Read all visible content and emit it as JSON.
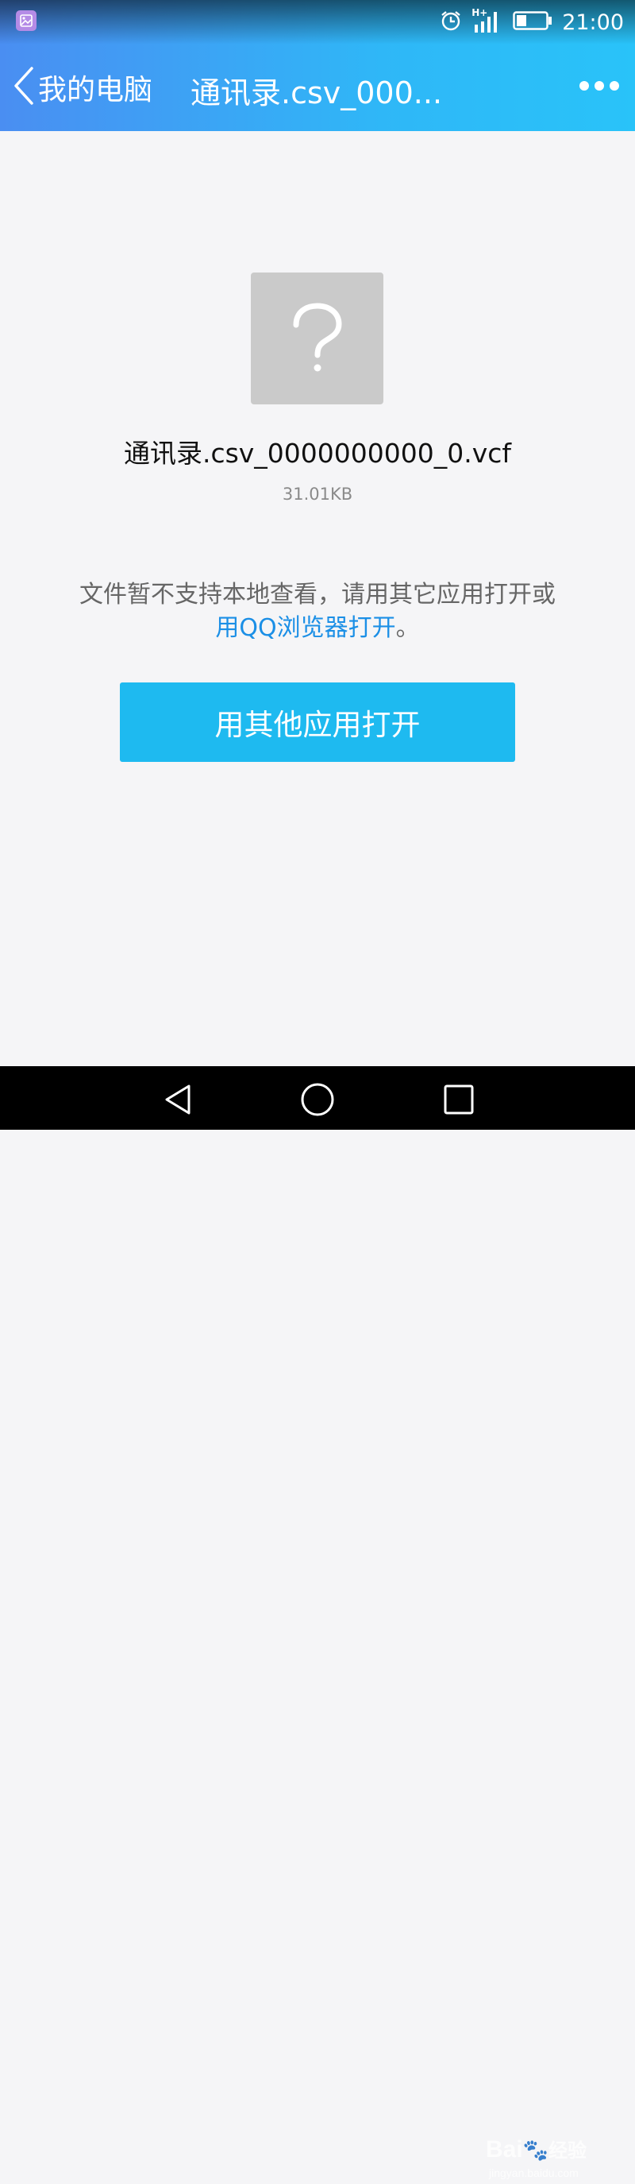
{
  "status_bar": {
    "time": "21:00",
    "network": "H+"
  },
  "title_bar": {
    "back_label": "我的电脑",
    "title": "通讯录.csv_000..."
  },
  "file": {
    "name": "通讯录.csv_0000000000_0.vcf",
    "size": "31.01KB",
    "icon": "question-mark-icon"
  },
  "message": {
    "line1": "文件暂不支持本地查看，请用其它应用打开或",
    "link": "用QQ浏览器打开",
    "suffix": "。"
  },
  "open_button_label": "用其他应用打开",
  "watermark": {
    "logo": "Bai",
    "logo_cn": "经验",
    "url": "jingyan.baidu.com"
  },
  "colors": {
    "header_start": "#4a8ef2",
    "header_end": "#29c3f9",
    "button": "#1ebaf0",
    "link": "#1b8fe6"
  }
}
